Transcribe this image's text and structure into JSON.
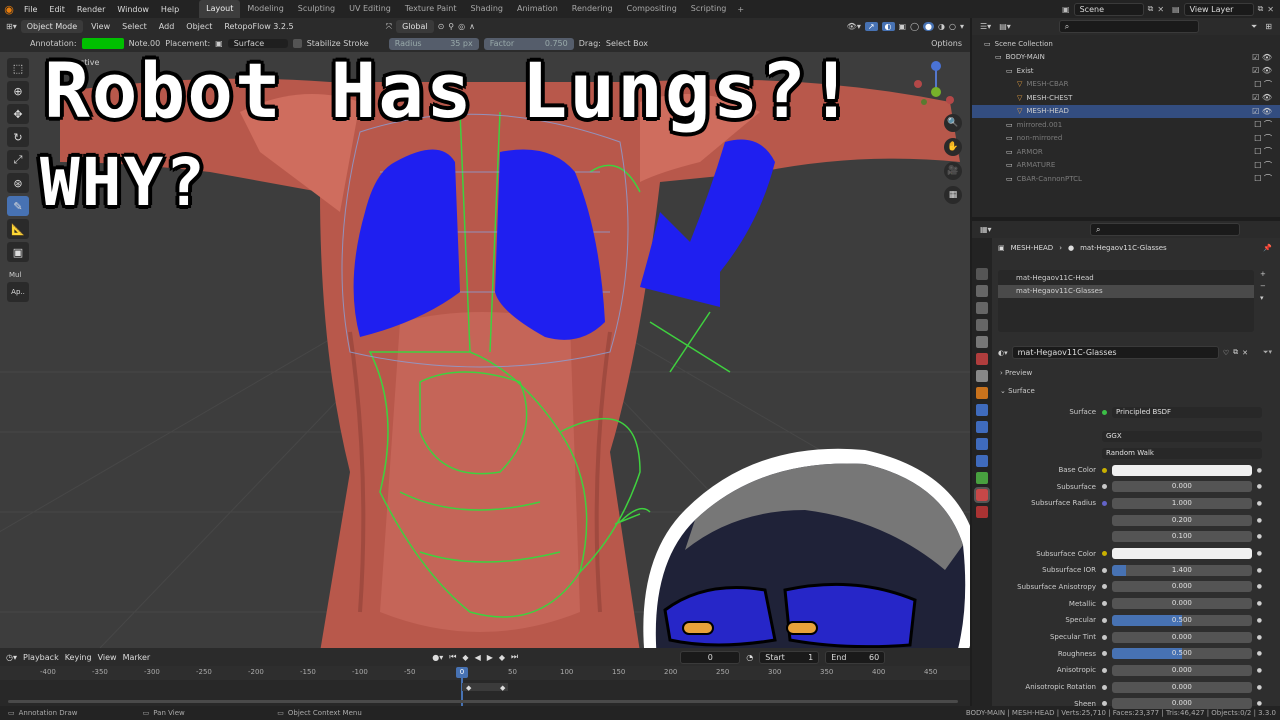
{
  "topbar": {
    "menus": [
      "File",
      "Edit",
      "Render",
      "Window",
      "Help"
    ],
    "workspaces": [
      "Layout",
      "Modeling",
      "Sculpting",
      "UV Editing",
      "Texture Paint",
      "Shading",
      "Animation",
      "Rendering",
      "Compositing",
      "Scripting"
    ],
    "active_workspace": "Layout",
    "scene": "Scene",
    "view_layer": "View Layer"
  },
  "viewport_header": {
    "mode": "Object Mode",
    "menus": [
      "View",
      "Select",
      "Add",
      "Object"
    ],
    "addon": "RetopoFlow 3.2.5",
    "orientation": "Global",
    "options": "Options"
  },
  "tool_header": {
    "annotation_label": "Annotation:",
    "note": "Note.00",
    "placement_label": "Placement:",
    "placement": "Surface",
    "stabilize": "Stabilize Stroke",
    "radius_label": "Radius",
    "radius_value": "35 px",
    "factor_label": "Factor",
    "factor_value": "0.750",
    "drag_label": "Drag:",
    "drag_value": "Select Box",
    "annotation_color": "#00c000"
  },
  "thumbnail": {
    "title_line1": "Robot Has Lungs?!",
    "title_line2": "WHY?"
  },
  "viewport": {
    "overlay_text_1": "ctive",
    "side_label_1": "Mul",
    "side_label_2": "Ap.."
  },
  "timeline_header": {
    "menus": [
      "Playback",
      "Keying",
      "View",
      "Marker"
    ],
    "current_frame": "0",
    "start_label": "Start",
    "start": "1",
    "end_label": "End",
    "end": "60"
  },
  "timeline": {
    "ticks": [
      "-400",
      "-350",
      "-300",
      "-250",
      "-200",
      "-150",
      "-100",
      "-50",
      "0",
      "50",
      "100",
      "150",
      "200",
      "250",
      "300",
      "350",
      "400",
      "450"
    ],
    "playhead": "0"
  },
  "statusbar": {
    "left": "Annotation Draw",
    "mid": "Pan View",
    "ctx": "Object Context Menu",
    "stats": "BODY-MAIN | MESH-HEAD | Verts:25,710 | Faces:23,377 | Tris:46,427 | Objects:0/2 | 3.3.0"
  },
  "outliner": {
    "rows": [
      {
        "label": "Scene Collection",
        "indent": 0,
        "dim": false
      },
      {
        "label": "BODY-MAIN",
        "indent": 1,
        "dim": false
      },
      {
        "label": "Exist",
        "indent": 2,
        "dim": false
      },
      {
        "label": "MESH-CBAR",
        "indent": 3,
        "dim": true
      },
      {
        "label": "MESH-CHEST",
        "indent": 3,
        "dim": false
      },
      {
        "label": "MESH-HEAD",
        "indent": 3,
        "dim": false,
        "selected": true
      },
      {
        "label": "mirrored.001",
        "indent": 2,
        "dim": true
      },
      {
        "label": "non-mirrored",
        "indent": 2,
        "dim": true
      },
      {
        "label": "ARMOR",
        "indent": 2,
        "dim": true
      },
      {
        "label": "ARMATURE",
        "indent": 2,
        "dim": true
      },
      {
        "label": "CBAR-CannonPTCL",
        "indent": 2,
        "dim": true
      }
    ]
  },
  "properties": {
    "breadcrumb_object": "MESH-HEAD",
    "breadcrumb_material": "mat-Hegaov11C-Glasses",
    "slots": [
      "mat-Hegaov11C-Head",
      "mat-Hegaov11C-Glasses"
    ],
    "active_slot": "mat-Hegaov11C-Glasses",
    "material_name": "mat-Hegaov11C-Glasses",
    "preview_label": "Preview",
    "surface_panel": "Surface",
    "surface_label": "Surface",
    "surface_value": "Principled BSDF",
    "distribution": "GGX",
    "subsurface_method": "Random Walk",
    "fields": [
      {
        "label": "Base Color",
        "value": "",
        "kind": "color",
        "dot": "#c9b000"
      },
      {
        "label": "Subsurface",
        "value": "0.000",
        "fill": 0
      },
      {
        "label": "Subsurface Radius",
        "value": "1.000",
        "fill": 0,
        "dot": "#6363c7"
      },
      {
        "label": "",
        "value": "0.200",
        "fill": 0
      },
      {
        "label": "",
        "value": "0.100",
        "fill": 0
      },
      {
        "label": "Subsurface Color",
        "value": "",
        "kind": "color",
        "dot": "#c9b000"
      },
      {
        "label": "Subsurface IOR",
        "value": "1.400",
        "fill": 0.1
      },
      {
        "label": "Subsurface Anisotropy",
        "value": "0.000",
        "fill": 0
      },
      {
        "label": "Metallic",
        "value": "0.000",
        "fill": 0
      },
      {
        "label": "Specular",
        "value": "0.500",
        "fill": 0.5
      },
      {
        "label": "Specular Tint",
        "value": "0.000",
        "fill": 0
      },
      {
        "label": "Roughness",
        "value": "0.500",
        "fill": 0.5
      },
      {
        "label": "Anisotropic",
        "value": "0.000",
        "fill": 0
      },
      {
        "label": "Anisotropic Rotation",
        "value": "0.000",
        "fill": 0
      },
      {
        "label": "Sheen",
        "value": "0.000",
        "fill": 0
      }
    ]
  }
}
